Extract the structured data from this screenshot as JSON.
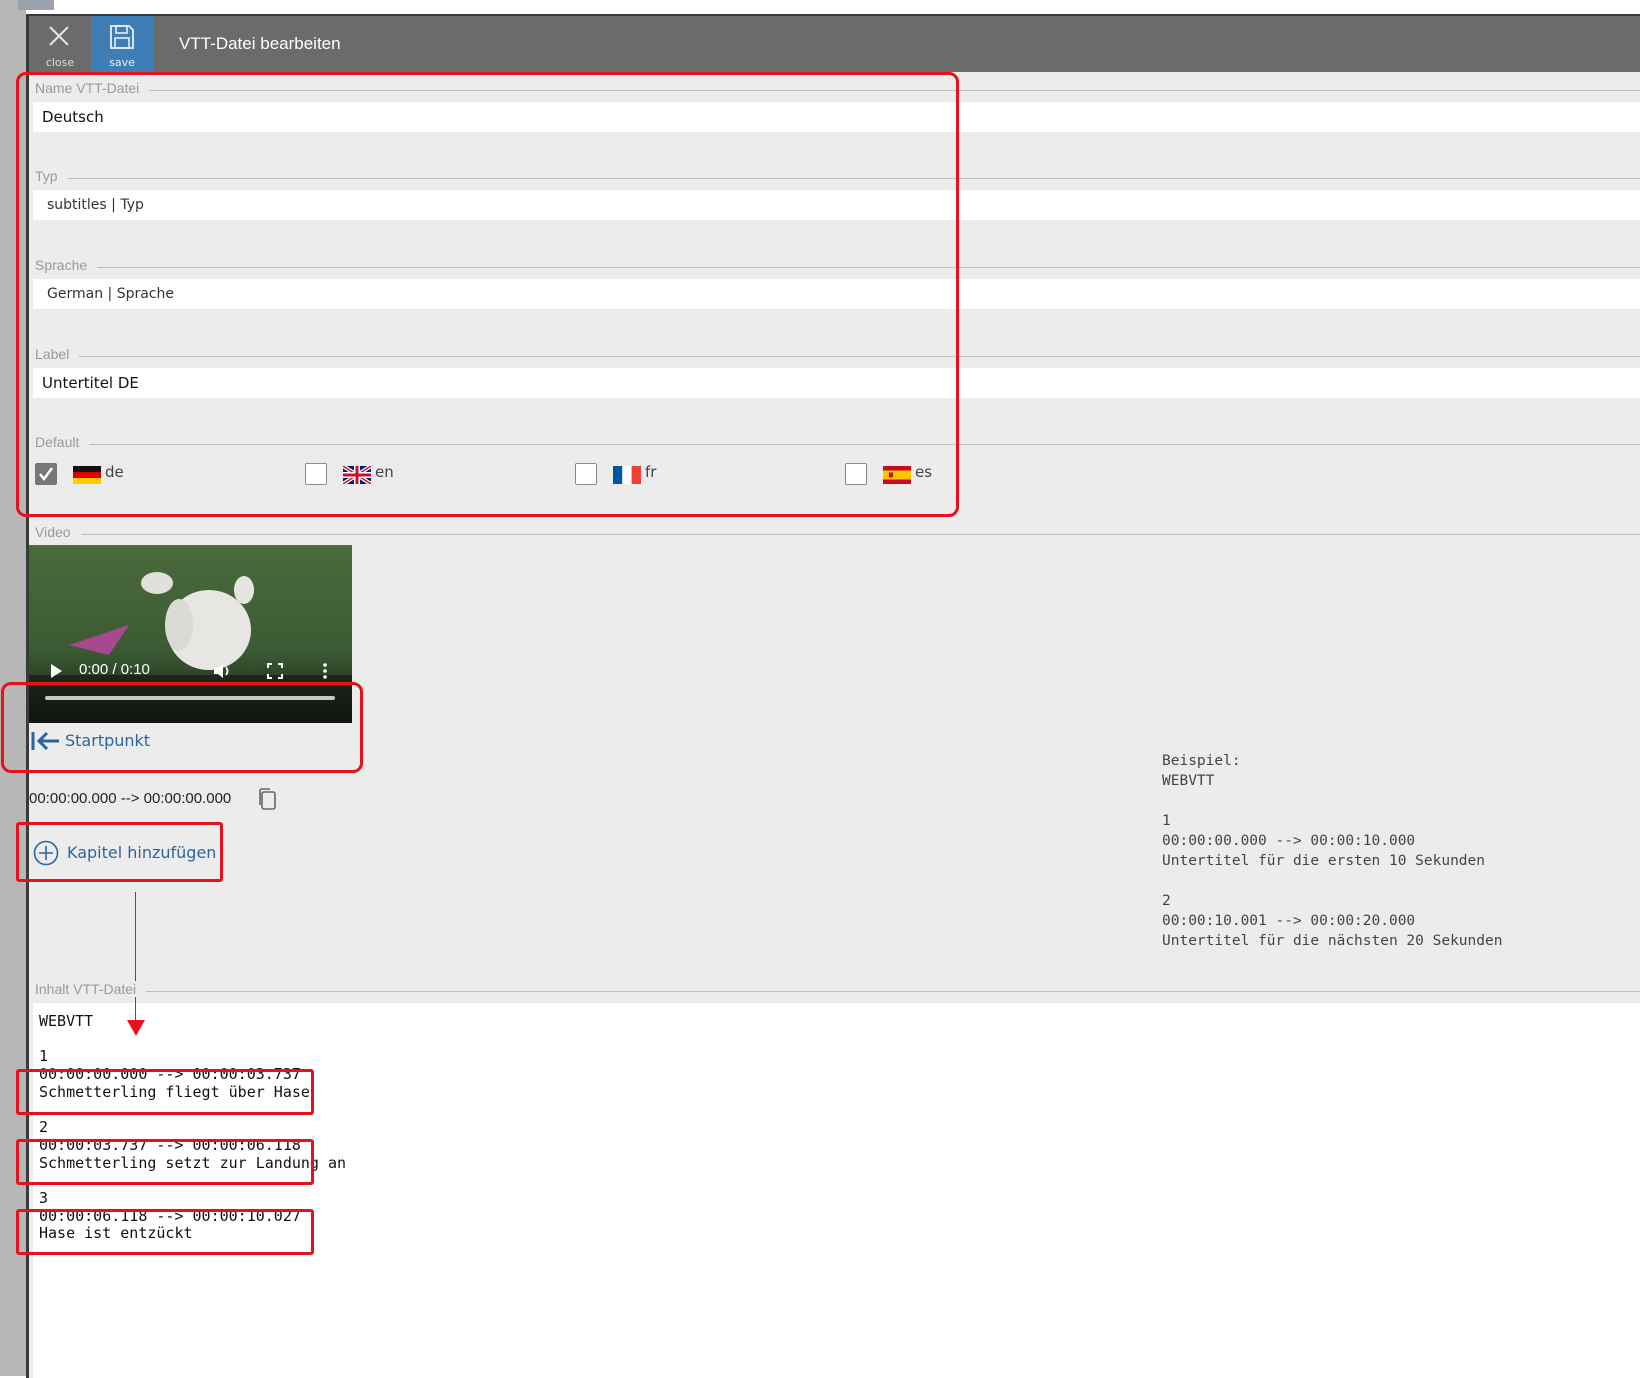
{
  "dialog": {
    "title": "VTT-Datei bearbeiten",
    "close_label": "close",
    "save_label": "save"
  },
  "form": {
    "name": {
      "legend": "Name VTT-Datei",
      "value": "Deutsch"
    },
    "typ": {
      "legend": "Typ",
      "value": "subtitles",
      "suffix": "Typ"
    },
    "sprache": {
      "legend": "Sprache",
      "value": "German",
      "suffix": "Sprache"
    },
    "label": {
      "legend": "Label",
      "value": "Untertitel DE"
    },
    "default": {
      "legend": "Default",
      "options": [
        {
          "code": "de",
          "checked": true
        },
        {
          "code": "en",
          "checked": false
        },
        {
          "code": "fr",
          "checked": false
        },
        {
          "code": "es",
          "checked": false
        }
      ]
    }
  },
  "video": {
    "legend": "Video",
    "time": "0:00 / 0:10",
    "startpunkt_label": "Startpunkt",
    "timecode": "00:00:00.000 --> 00:00:00.000",
    "add_chapter_label": "Kapitel hinzufügen"
  },
  "example": {
    "text": "Beispiel:\nWEBVTT\n\n1\n00:00:00.000 --> 00:00:10.000\nUntertitel für die ersten 10 Sekunden\n\n2\n00:00:10.001 --> 00:00:20.000\nUntertitel für die nächsten 20 Sekunden"
  },
  "vtt_content": {
    "legend": "Inhalt VTT-Datei",
    "header": "WEBVTT",
    "cues": [
      {
        "index": "1",
        "timing": "00:00:00.000 --> 00:00:03.737",
        "text": "Schmetterling fliegt über Hase"
      },
      {
        "index": "2",
        "timing": "00:00:03.737 --> 00:00:06.118",
        "text": "Schmetterling setzt zur Landung an"
      },
      {
        "index": "3",
        "timing": "00:00:06.118 --> 00:00:10.027",
        "text": "Hase ist entzückt"
      }
    ]
  },
  "colors": {
    "topbar": "#6b6b6b",
    "save_button": "#3e7db6",
    "link": "#2c64a0",
    "annotation": "#e8101a"
  }
}
